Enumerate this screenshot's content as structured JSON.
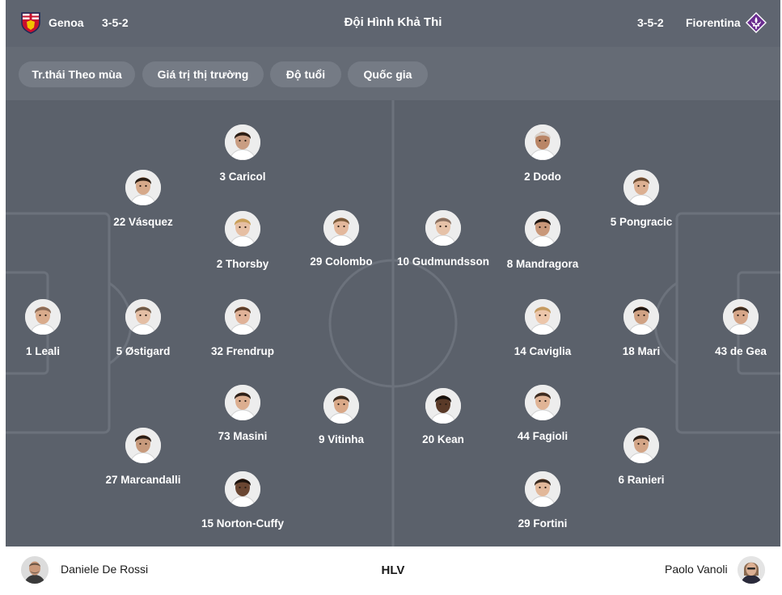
{
  "header": {
    "title": "Đội Hình Khả Thi",
    "home": {
      "name": "Genoa",
      "formation": "3-5-2",
      "logo_icon": "genoa-crest-icon",
      "colors": [
        "#c8102e",
        "#1b2a5a"
      ]
    },
    "away": {
      "name": "Fiorentina",
      "formation": "3-5-2",
      "logo_icon": "fiorentina-lily-icon",
      "color": "#6b2d90"
    }
  },
  "filters": [
    {
      "label": "Tr.thái Theo mùa"
    },
    {
      "label": "Giá trị thị trường"
    },
    {
      "label": "Độ tuổi"
    },
    {
      "label": "Quốc gia"
    }
  ],
  "home_players": [
    {
      "label": "3 Caricol",
      "skin": "#c99d82",
      "hair": "#2b1d14"
    },
    {
      "label": "22 Vásquez",
      "skin": "#d6a98a",
      "hair": "#2a1c12"
    },
    {
      "label": "2 Thorsby",
      "skin": "#e6bfa3",
      "hair": "#c9a05a"
    },
    {
      "label": "29 Colombo",
      "skin": "#e3b89c",
      "hair": "#7a5a3a"
    },
    {
      "label": "1 Leali",
      "skin": "#d9ab8c",
      "hair": "#8a6a55"
    },
    {
      "label": "5 Østigard",
      "skin": "#e4bea4",
      "hair": "#6d5846"
    },
    {
      "label": "32 Frendrup",
      "skin": "#e0b298",
      "hair": "#5a3c28"
    },
    {
      "label": "73 Masini",
      "skin": "#dcae90",
      "hair": "#2e2018"
    },
    {
      "label": "9 Vitinha",
      "skin": "#d9a888",
      "hair": "#3a2a1e"
    },
    {
      "label": "27 Marcandalli",
      "skin": "#c79a7c",
      "hair": "#2a1d15"
    },
    {
      "label": "15 Norton-Cuffy",
      "skin": "#6a4632",
      "hair": "#1c120c"
    }
  ],
  "away_players": [
    {
      "label": "2 Dodo",
      "skin": "#b98566",
      "hair": "#d9d0c8"
    },
    {
      "label": "5 Pongracic",
      "skin": "#dcb092",
      "hair": "#6a4a30"
    },
    {
      "label": "10 Gudmundsson",
      "skin": "#e6c2a8",
      "hair": "#8a7060"
    },
    {
      "label": "8 Mandragora",
      "skin": "#c9987a",
      "hair": "#1e1510"
    },
    {
      "label": "14 Caviglia",
      "skin": "#ecc6aa",
      "hair": "#c49a60"
    },
    {
      "label": "18 Mari",
      "skin": "#d0a284",
      "hair": "#1e1510"
    },
    {
      "label": "43 de Gea",
      "skin": "#d6a688",
      "hair": "#3a2a1e"
    },
    {
      "label": "20 Kean",
      "skin": "#5a3a28",
      "hair": "#16100c"
    },
    {
      "label": "44 Fagioli",
      "skin": "#e0b496",
      "hair": "#3e2c20"
    },
    {
      "label": "6 Ranieri",
      "skin": "#d3a587",
      "hair": "#2a1d15"
    },
    {
      "label": "29 Fortini",
      "skin": "#e2b89a",
      "hair": "#3a2a1e"
    }
  ],
  "footer": {
    "label": "HLV",
    "home_coach": "Daniele De Rossi",
    "away_coach": "Paolo Vanoli"
  }
}
